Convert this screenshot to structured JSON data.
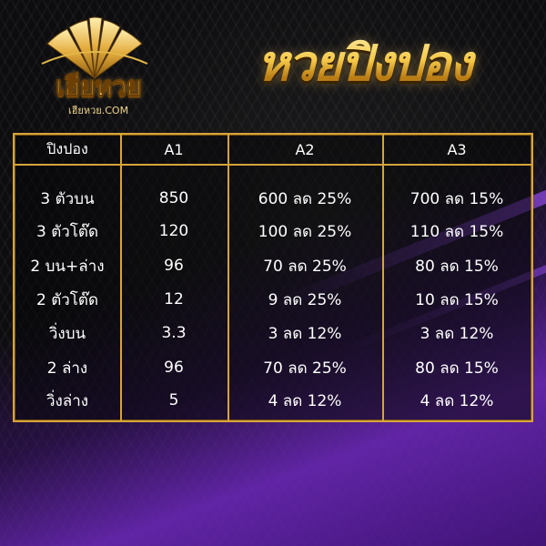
{
  "logo": {
    "brand": "เฮียหวย",
    "site": "เฮียหวย.COM"
  },
  "title": "หวยปิงปอง",
  "colors": {
    "gold": "#d6a43a",
    "purple": "#7a2fd0",
    "background": "#0d0d0f",
    "text": "#ffffff"
  },
  "table": {
    "headers": [
      "ปิงปอง",
      "A1",
      "A2",
      "A3"
    ],
    "rows": [
      [
        "3 ตัวบน",
        "850",
        "600 ลด 25%",
        "700 ลด 15%"
      ],
      [
        "3 ตัวโต๊ด",
        "120",
        "100 ลด 25%",
        "110 ลด 15%"
      ],
      [
        "2 บน+ล่าง",
        "96",
        "70 ลด 25%",
        "80 ลด 15%"
      ],
      [
        "2 ตัวโต๊ด",
        "12",
        "9 ลด 25%",
        "10 ลด 15%"
      ],
      [
        "วิ่งบน",
        "3.3",
        "3 ลด 12%",
        "3 ลด 12%"
      ],
      [
        "2 ล่าง",
        "96",
        "70 ลด 25%",
        "80 ลด 15%"
      ],
      [
        "วิ่งล่าง",
        "5",
        "4 ลด 12%",
        "4 ลด 12%"
      ]
    ]
  }
}
